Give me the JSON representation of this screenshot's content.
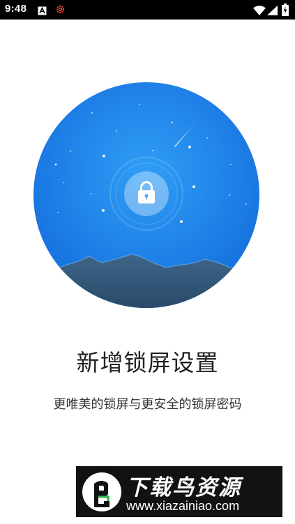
{
  "status_bar": {
    "time": "9:48",
    "left_icons": [
      "font-a-icon",
      "settings-gear-icon"
    ],
    "right_icons": [
      "wifi-icon",
      "signal-icon",
      "battery-charging-icon"
    ]
  },
  "hero": {
    "icon": "lock-icon",
    "sky_color": "#1a7fe8",
    "mountain_color": "#35597d"
  },
  "page": {
    "title": "新增锁屏设置",
    "subtitle": "更唯美的锁屏与更安全的锁屏密码"
  },
  "watermark": {
    "title": "下载鸟资源",
    "url": "www.xiazainiao.com",
    "icon": "bird-logo-icon"
  }
}
